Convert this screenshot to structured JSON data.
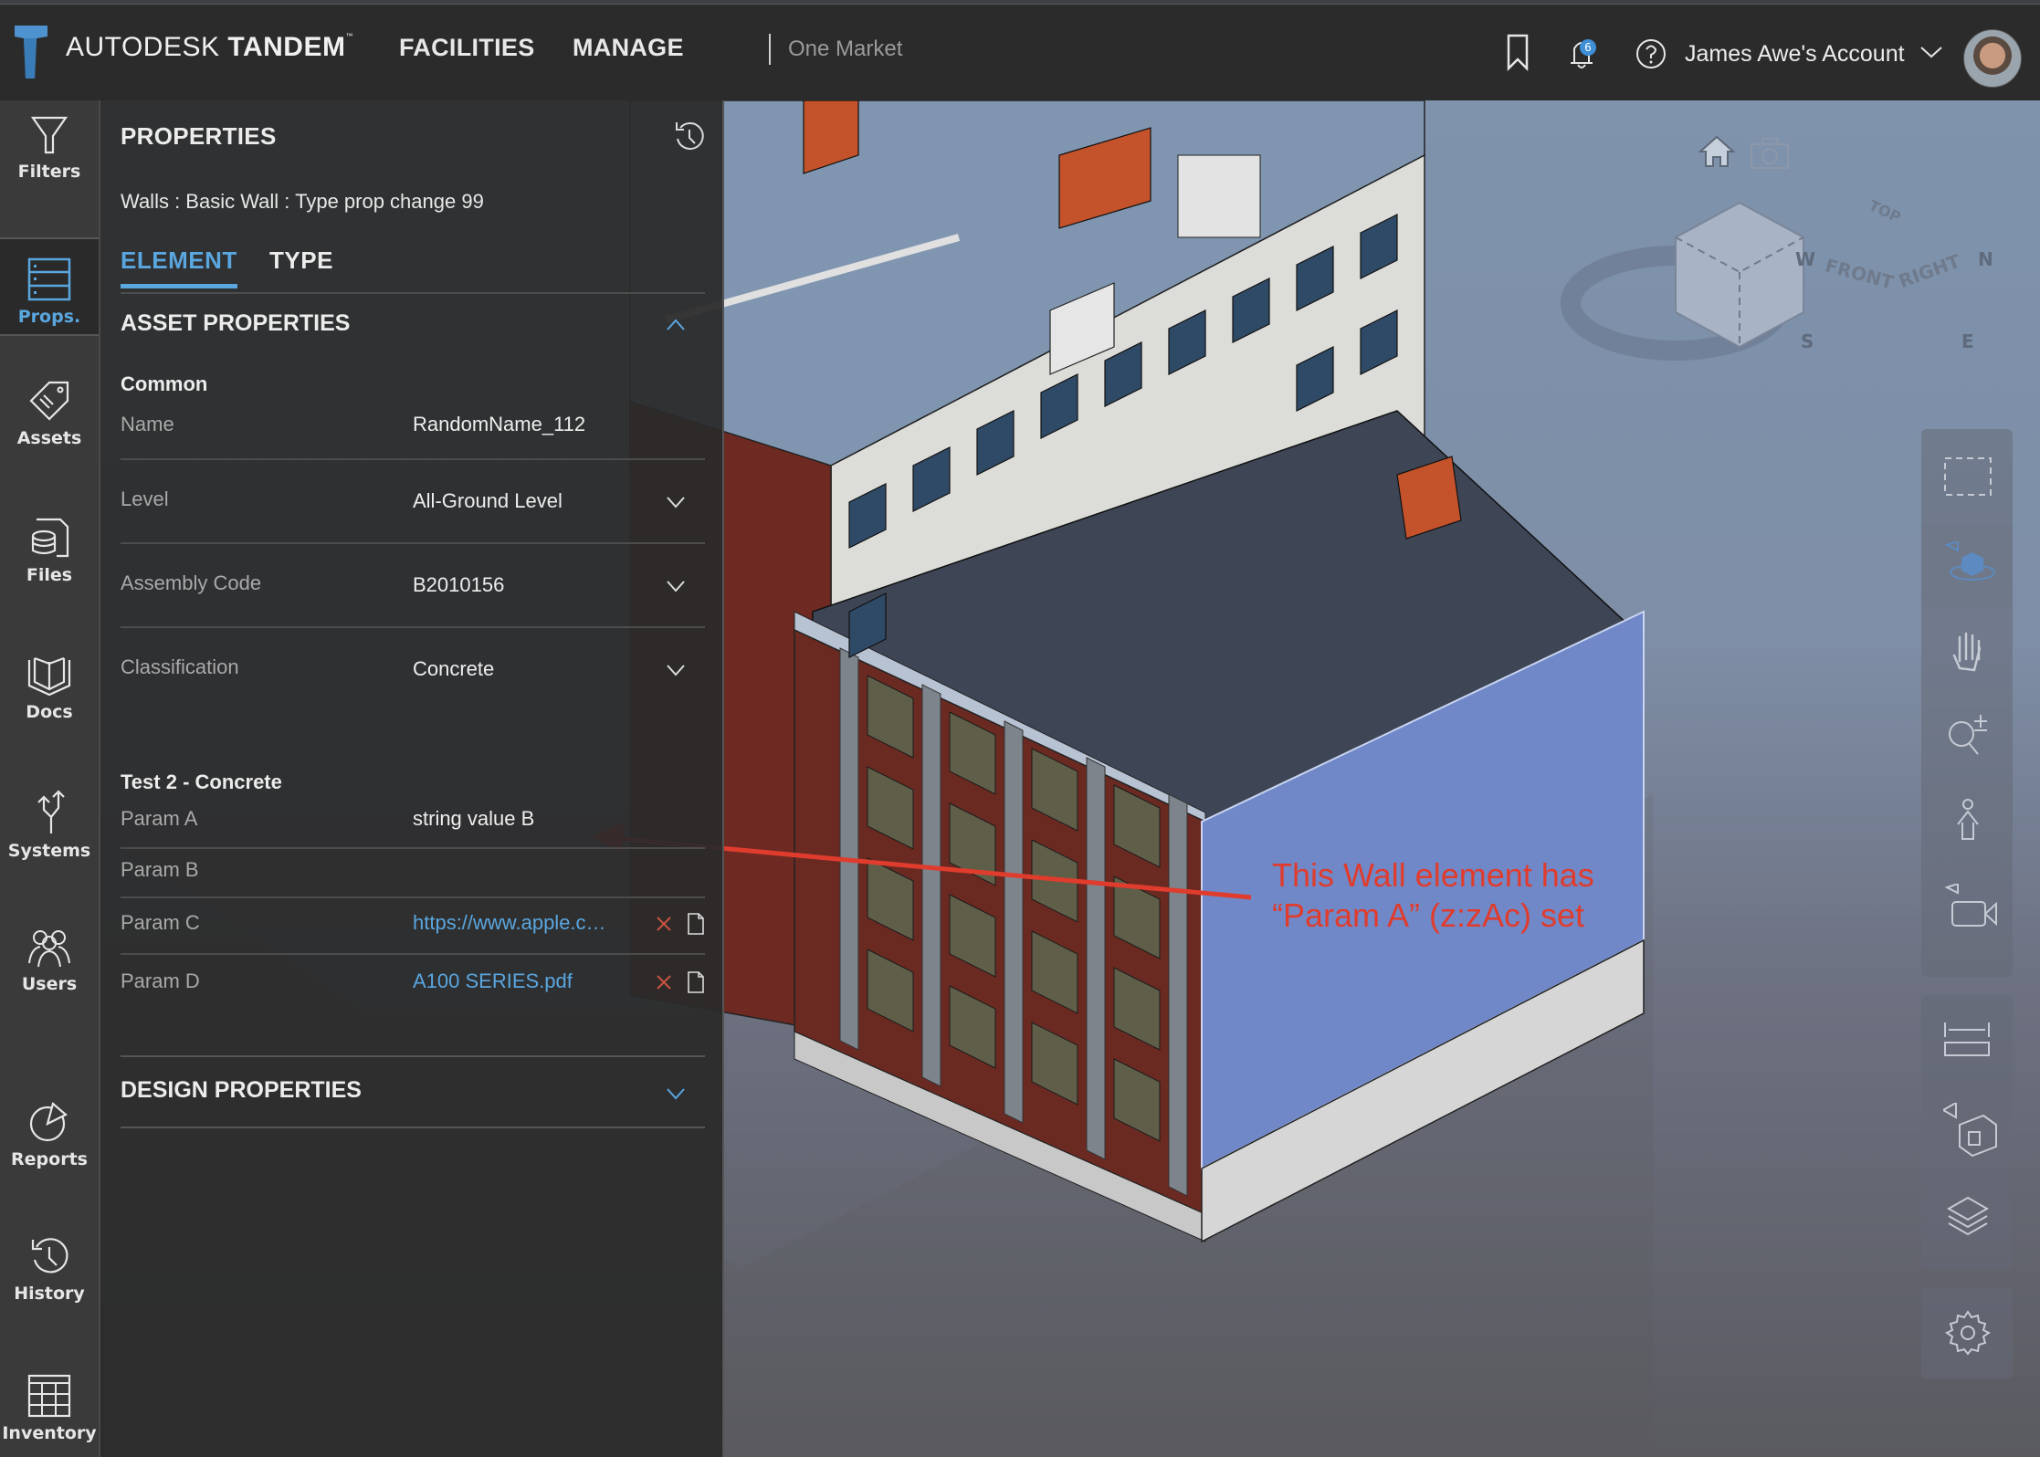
{
  "header": {
    "brand_light": "AUTODESK",
    "brand_bold": "TANDEM",
    "trademark": "™",
    "nav": [
      {
        "label": "FACILITIES"
      },
      {
        "label": "MANAGE"
      }
    ],
    "facility_name": "One Market",
    "notification_count": "6",
    "account_label": "James Awe's Account",
    "icons": [
      "bookmark-icon",
      "bell-icon",
      "help-icon",
      "chevron-down-icon",
      "avatar"
    ]
  },
  "sidebar": {
    "items": [
      {
        "label": "Filters",
        "icon": "filter-icon"
      },
      {
        "label": "Props.",
        "icon": "properties-icon",
        "active": true
      },
      {
        "label": "Assets",
        "icon": "tag-icon"
      },
      {
        "label": "Files",
        "icon": "database-file-icon"
      },
      {
        "label": "Docs",
        "icon": "book-icon"
      },
      {
        "label": "Systems",
        "icon": "split-arrows-icon"
      },
      {
        "label": "Users",
        "icon": "users-icon"
      },
      {
        "label": "Reports",
        "icon": "pie-chart-icon"
      },
      {
        "label": "History",
        "icon": "history-icon"
      },
      {
        "label": "Inventory",
        "icon": "table-icon"
      }
    ]
  },
  "panel": {
    "title": "PROPERTIES",
    "element_name": "Walls : Basic Wall : Type prop change 99",
    "tabs": [
      {
        "label": "ELEMENT",
        "active": true
      },
      {
        "label": "TYPE",
        "active": false
      }
    ],
    "asset_section": {
      "title": "ASSET PROPERTIES",
      "expanded": true,
      "groups": [
        {
          "title": "Common",
          "rows": [
            {
              "key": "Name",
              "value": "RandomName_112"
            },
            {
              "key": "Level",
              "value": "All-Ground Level",
              "dropdown": true
            },
            {
              "key": "Assembly Code",
              "value": "B2010156",
              "dropdown": true
            },
            {
              "key": "Classification",
              "value": "Concrete",
              "dropdown": true
            }
          ]
        },
        {
          "title": "Test 2 - Concrete",
          "rows": [
            {
              "key": "Param A",
              "value": "string value B"
            },
            {
              "key": "Param B",
              "value": ""
            },
            {
              "key": "Param C",
              "value": "https://www.apple.c…",
              "link": true
            },
            {
              "key": "Param D",
              "value": "A100 SERIES.pdf",
              "link": true
            }
          ]
        }
      ]
    },
    "design_section": {
      "title": "DESIGN PROPERTIES",
      "expanded": false
    }
  },
  "viewer": {
    "viewcube": {
      "top": "TOP",
      "front": "FRONT",
      "right": "RIGHT",
      "compass": [
        "N",
        "E",
        "S",
        "W"
      ]
    },
    "tools": [
      "box-select-icon",
      "orbit-icon",
      "pan-icon",
      "zoom-icon",
      "first-person-icon",
      "camera-icon",
      "measure-icon",
      "section-icon",
      "layers-icon",
      "settings-icon"
    ],
    "selected_color": "#7088c8",
    "annotation": {
      "line1": "This Wall element has",
      "line2": "“Param A” (z:zAc) set",
      "color": "#e03c2d"
    }
  }
}
